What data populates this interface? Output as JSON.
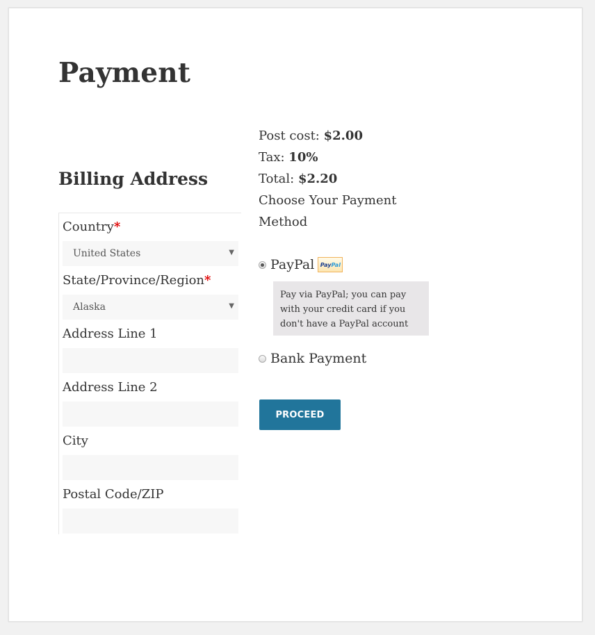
{
  "page": {
    "title": "Payment"
  },
  "billing": {
    "title": "Billing Address",
    "fields": [
      {
        "label": "Country",
        "required_mark": "*",
        "type": "select",
        "value": "United States"
      },
      {
        "label": "State/Province/Region",
        "required_mark": "*",
        "type": "select",
        "value": "Alaska"
      },
      {
        "label": "Address Line 1",
        "type": "text",
        "value": ""
      },
      {
        "label": "Address Line 2",
        "type": "text",
        "value": ""
      },
      {
        "label": "City",
        "type": "text",
        "value": ""
      },
      {
        "label": "Postal Code/ZIP",
        "type": "text",
        "value": ""
      }
    ],
    "select_caret": "▼"
  },
  "summary": {
    "post_cost_label": "Post cost:",
    "post_cost_value": "$2.00",
    "tax_label": "Tax:",
    "tax_value": "10%",
    "total_label": "Total:",
    "total_value": "$2.20",
    "choose_label": "Choose Your Payment Method"
  },
  "payment_methods": [
    {
      "label": "PayPal",
      "selected": true,
      "badge_pay": "Pay",
      "badge_pal": "Pal",
      "description": "Pay via PayPal; you can pay with your credit card if you don't have a PayPal account"
    },
    {
      "label": "Bank Payment",
      "selected": false
    }
  ],
  "actions": {
    "proceed_label": "PROCEED"
  },
  "colors": {
    "button": "#21759b",
    "required": "#e00000",
    "input_bg": "#f7f7f7",
    "background": "#f1f1f1"
  }
}
